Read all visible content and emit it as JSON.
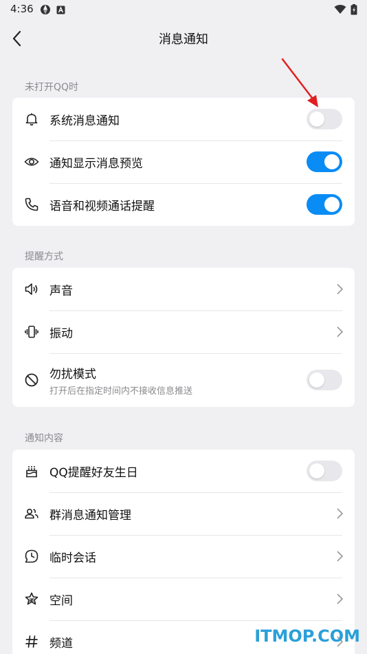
{
  "status_bar": {
    "time": "4:36"
  },
  "header": {
    "title": "消息通知",
    "back_icon": "back-arrow-icon"
  },
  "sections": [
    {
      "label": "未打开QQ时",
      "items": [
        {
          "icon": "bell-icon",
          "label": "系统消息通知",
          "control": "toggle",
          "on": false
        },
        {
          "icon": "eye-icon",
          "label": "通知显示消息预览",
          "control": "toggle",
          "on": true
        },
        {
          "icon": "phone-icon",
          "label": "语音和视频通话提醒",
          "control": "toggle",
          "on": true
        }
      ]
    },
    {
      "label": "提醒方式",
      "items": [
        {
          "icon": "speaker-icon",
          "label": "声音",
          "control": "chevron"
        },
        {
          "icon": "vibrate-icon",
          "label": "振动",
          "control": "chevron"
        },
        {
          "icon": "do-not-disturb-icon",
          "label": "勿扰模式",
          "sublabel": "打开后在指定时间内不接收信息推送",
          "control": "toggle",
          "on": false
        }
      ]
    },
    {
      "label": "通知内容",
      "items": [
        {
          "icon": "cake-icon",
          "label": "QQ提醒好友生日",
          "control": "toggle",
          "on": false
        },
        {
          "icon": "group-icon",
          "label": "群消息通知管理",
          "control": "chevron"
        },
        {
          "icon": "clock-chat-icon",
          "label": "临时会话",
          "control": "chevron"
        },
        {
          "icon": "star-icon",
          "label": "空间",
          "control": "chevron"
        },
        {
          "icon": "hash-icon",
          "label": "频道",
          "control": "chevron"
        }
      ]
    }
  ],
  "colors": {
    "accent": "#0a8cf5",
    "background": "#f0f0f3",
    "annotation": "#e02020",
    "watermark": "#2aa0d8"
  },
  "watermark": "ITMOP.COM"
}
